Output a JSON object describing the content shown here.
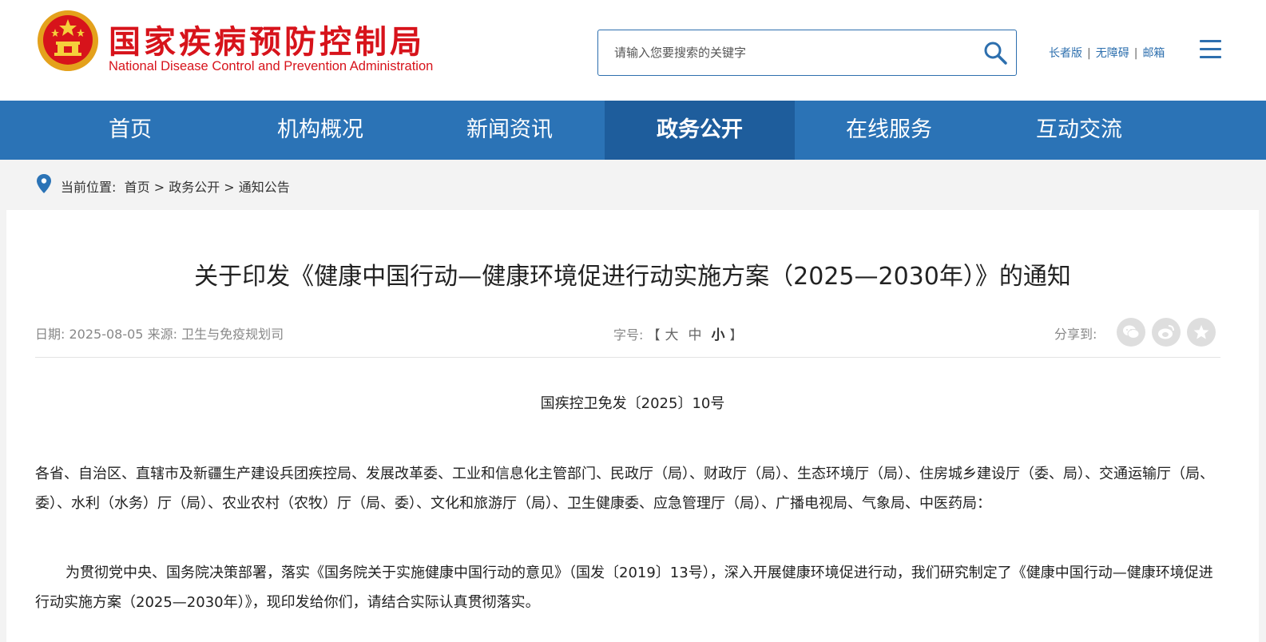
{
  "header": {
    "logo_cn": "国家疾病预防控制局",
    "logo_en": "National Disease Control and Prevention Administration",
    "search_placeholder": "请输入您要搜索的关键字",
    "links": [
      "长者版",
      "无障碍",
      "邮箱"
    ],
    "separator": "|"
  },
  "nav": {
    "items": [
      "首页",
      "机构概况",
      "新闻资讯",
      "政务公开",
      "在线服务",
      "互动交流"
    ],
    "active": "政务公开"
  },
  "breadcrumb": {
    "label": "当前位置:",
    "items": [
      "首页",
      "政务公开",
      "通知公告"
    ],
    "sep": ">"
  },
  "article": {
    "title": "关于印发《健康中国行动—健康环境促进行动实施方案（2025—2030年）》的通知",
    "date_label": "日期:",
    "date": "2025-08-05",
    "source_label": "来源:",
    "source": "卫生与免疫规划司",
    "font_label": "字号:",
    "bracket_open": "【",
    "bracket_close": "】",
    "font_sizes": [
      "大",
      "中",
      "小"
    ],
    "share_label": "分享到:",
    "share_icons": [
      "wechat-icon",
      "weibo-icon",
      "favorite-icon"
    ],
    "doc_number": "国疾控卫免发〔2025〕10号",
    "recipients": "各省、自治区、直辖市及新疆生产建设兵团疾控局、发展改革委、工业和信息化主管部门、民政厅（局）、财政厅（局）、生态环境厅（局）、住房城乡建设厅（委、局）、交通运输厅（局、委）、水利（水务）厅（局）、农业农村（农牧）厅（局、委）、文化和旅游厅（局）、卫生健康委、应急管理厅（局）、广播电视局、气象局、中医药局：",
    "paragraph1": "为贯彻党中央、国务院决策部署，落实《国务院关于实施健康中国行动的意见》（国发〔2019〕13号），深入开展健康环境促进行动，我们研究制定了《健康中国行动—健康环境促进行动实施方案（2025—2030年）》，现印发给你们，请结合实际认真贯彻落实。"
  },
  "colors": {
    "brand_red": "#d7131b",
    "nav_blue": "#2b73b6",
    "nav_active": "#1e5d9c",
    "link_blue": "#2d6fae"
  }
}
